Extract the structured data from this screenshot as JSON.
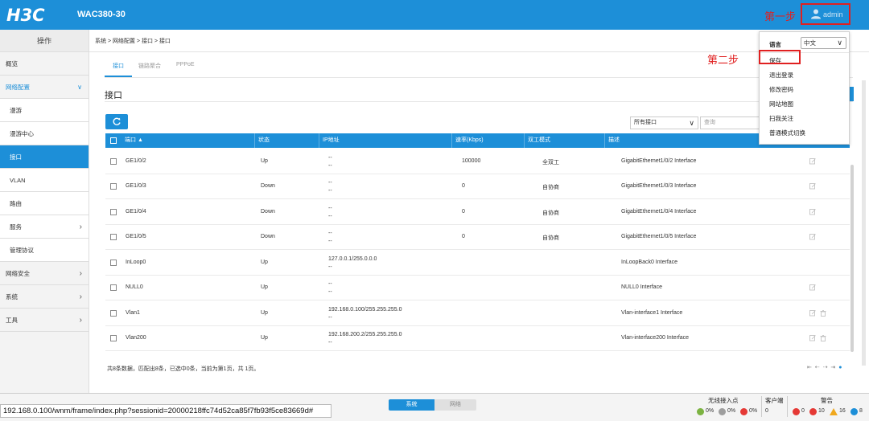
{
  "header": {
    "logo": "H3C",
    "model": "WAC380-30",
    "user": "admin",
    "step1": "第一步"
  },
  "sidebar": {
    "title": "操作",
    "items": [
      {
        "label": "概览",
        "type": "top"
      },
      {
        "label": "网络配置",
        "type": "top-open"
      },
      {
        "label": "漫游",
        "type": "sub"
      },
      {
        "label": "漫游中心",
        "type": "sub"
      },
      {
        "label": "接口",
        "type": "sub-active"
      },
      {
        "label": "VLAN",
        "type": "sub"
      },
      {
        "label": "路由",
        "type": "sub"
      },
      {
        "label": "服务",
        "type": "sub-arrow"
      },
      {
        "label": "管理协议",
        "type": "sub"
      },
      {
        "label": "网络安全",
        "type": "top-arrow"
      },
      {
        "label": "系统",
        "type": "top-arrow"
      },
      {
        "label": "工具",
        "type": "top-arrow"
      }
    ]
  },
  "breadcrumb": "系统 > 网络配置 > 接口 > 接口",
  "tabs": [
    {
      "label": "接口",
      "active": true
    },
    {
      "label": "链路聚合",
      "active": false
    },
    {
      "label": "PPPoE",
      "active": false
    }
  ],
  "section_title": "接口",
  "filter": {
    "selected": "所有接口",
    "search_placeholder": "查询"
  },
  "table": {
    "columns": [
      "端口",
      "状态",
      "IP地址",
      "速率(Kbps)",
      "双工模式",
      "描述"
    ],
    "sort_indicator": "▲",
    "rows": [
      {
        "port": "GE1/0/2",
        "status": "Up",
        "ip": "--",
        "ip2": "--",
        "speed": "100000",
        "duplex": "全双工",
        "desc": "GigabitEthernet1/0/2 Interface",
        "delete": false
      },
      {
        "port": "GE1/0/3",
        "status": "Down",
        "ip": "--",
        "ip2": "--",
        "speed": "0",
        "duplex": "自协商",
        "desc": "GigabitEthernet1/0/3 Interface",
        "delete": false
      },
      {
        "port": "GE1/0/4",
        "status": "Down",
        "ip": "--",
        "ip2": "--",
        "speed": "0",
        "duplex": "自协商",
        "desc": "GigabitEthernet1/0/4 Interface",
        "delete": false
      },
      {
        "port": "GE1/0/5",
        "status": "Down",
        "ip": "--",
        "ip2": "--",
        "speed": "0",
        "duplex": "自协商",
        "desc": "GigabitEthernet1/0/5 Interface",
        "delete": false
      },
      {
        "port": "InLoop0",
        "status": "Up",
        "ip": "127.0.0.1/255.0.0.0",
        "ip2": "--",
        "speed": "",
        "duplex": "",
        "desc": "InLoopBack0 Interface",
        "delete": false,
        "no_edit": true
      },
      {
        "port": "NULL0",
        "status": "Up",
        "ip": "--",
        "ip2": "--",
        "speed": "",
        "duplex": "",
        "desc": "NULL0 Interface",
        "delete": false
      },
      {
        "port": "Vlan1",
        "status": "Up",
        "ip": "192.168.0.100/255.255.255.0",
        "ip2": "--",
        "speed": "",
        "duplex": "",
        "desc": "Vlan-interface1 Interface",
        "delete": true
      },
      {
        "port": "Vlan200",
        "status": "Up",
        "ip": "192.168.200.2/255.255.255.0",
        "ip2": "--",
        "speed": "",
        "duplex": "",
        "desc": "Vlan-interface200 Interface",
        "delete": true
      }
    ]
  },
  "summary": "共8条数据，匹配出8条，已选中0条，当前为第1页，共 1页。",
  "pager": "⇤ ⇠ ⇢ ⇥",
  "dropdown": {
    "lang_label": "语言",
    "lang_value": "中文",
    "items": [
      "保存",
      "退出登录",
      "修改密码",
      "网站地图",
      "扫我关注",
      "普通模式切换"
    ],
    "step2": "第二步"
  },
  "statusbar": {
    "url": "192.168.0.100/wnm/frame/index.php?sessionid=20000218ffc74d52ca85f7fb93f5ce83669d#",
    "mode_system": "系统",
    "mode_network": "网络",
    "wireless_label": "无线接入点",
    "client_label": "客户端",
    "alarm_label": "警告",
    "ap_online": "0%",
    "ap_offline": "0%",
    "ap_fault": "0%",
    "clients": "0",
    "alarm_critical": "0",
    "alarm_major": "10",
    "alarm_minor": "16",
    "alarm_info": "8",
    "colors": {
      "green": "#7cb342",
      "grey": "#9e9e9e",
      "red": "#e53935",
      "orange": "#f0a81e",
      "blue": "#1d8fd8"
    }
  }
}
